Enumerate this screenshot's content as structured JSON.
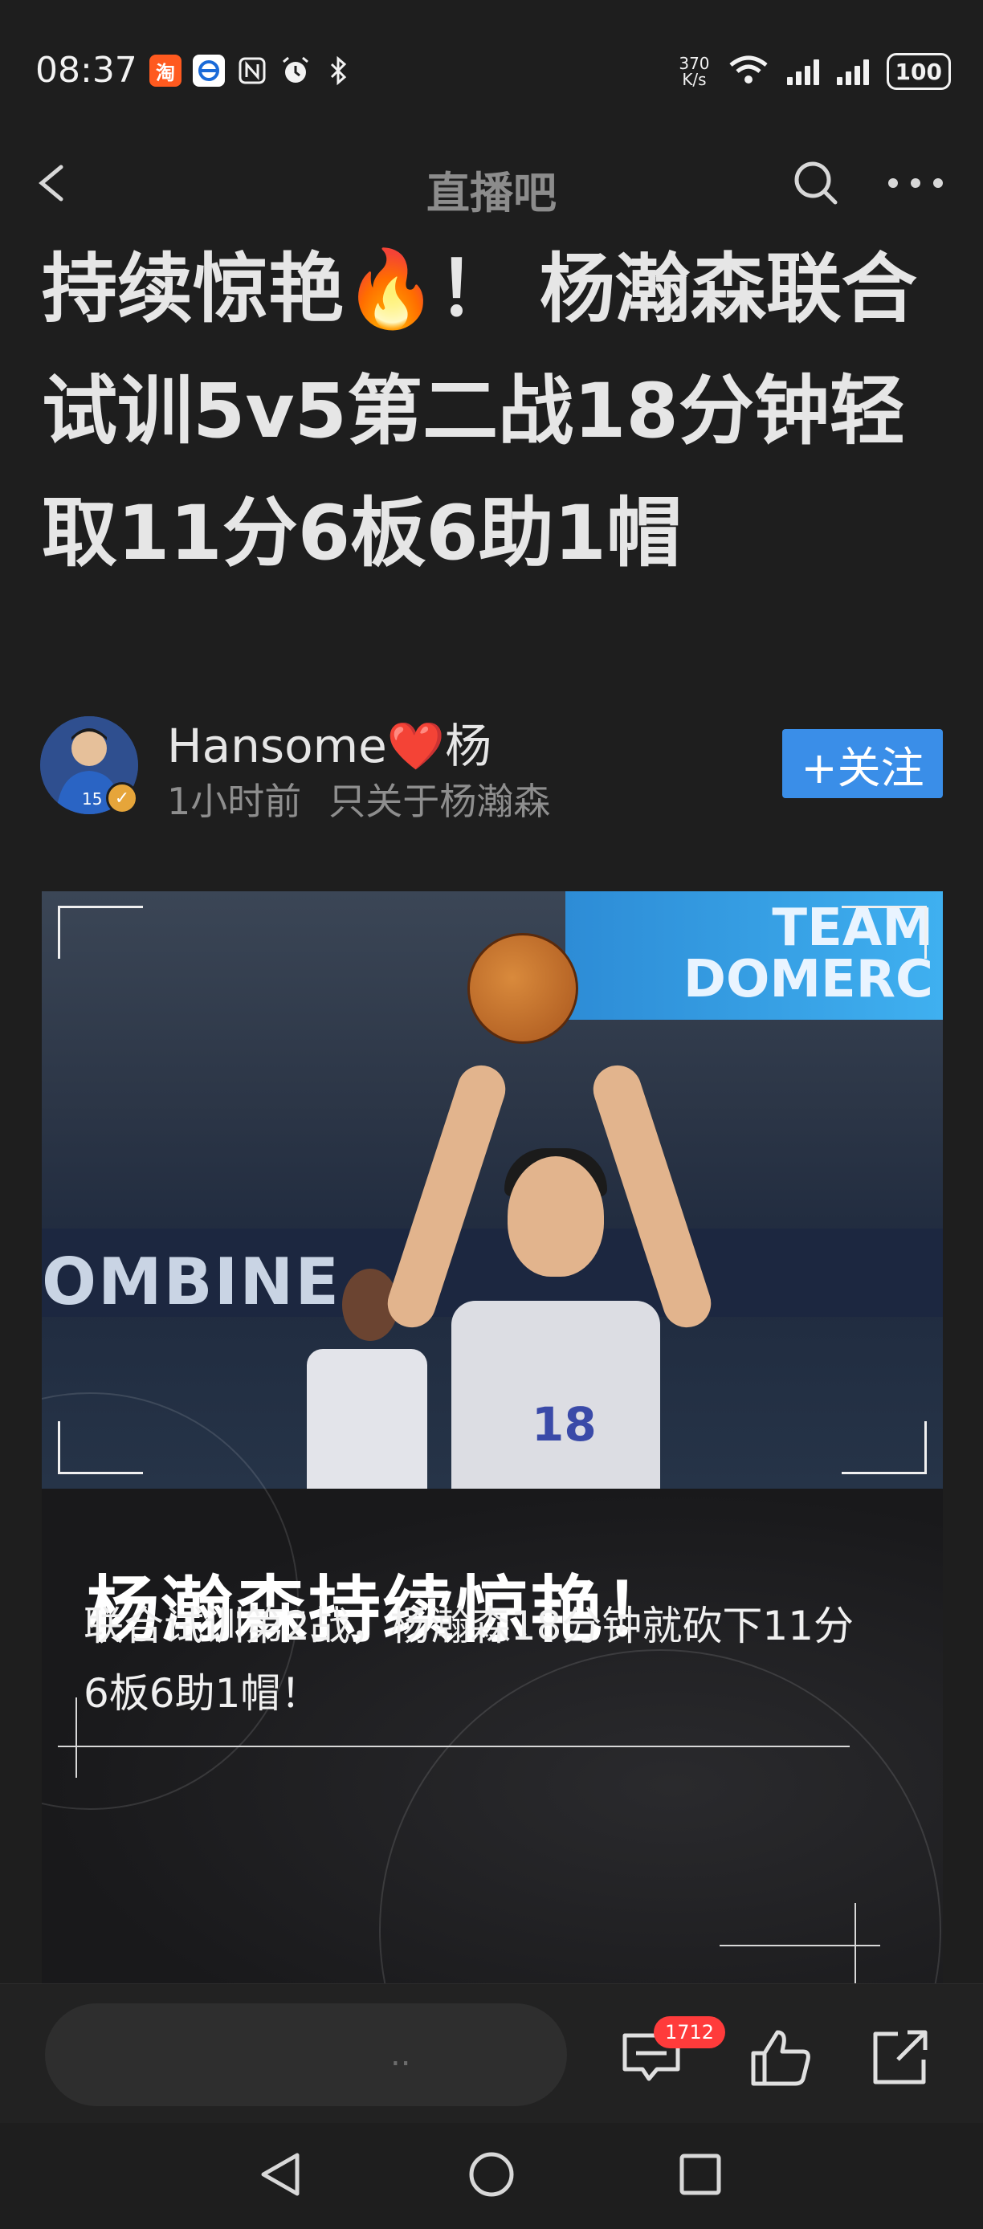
{
  "status_bar": {
    "time": "08:37",
    "left_icons": [
      "taobao-icon",
      "telecom-icon",
      "nfc-icon",
      "alarm-icon",
      "bluetooth-icon"
    ],
    "net_speed_value": "370",
    "net_speed_unit": "K/s",
    "battery": "100"
  },
  "nav": {
    "title": "直播吧"
  },
  "post": {
    "title": "持续惊艳🔥！ 杨瀚森联合试训5v5第二战18分钟轻取11分6板6助1帽"
  },
  "author": {
    "name": "Hansome❤️杨",
    "time": "1小时前",
    "tagline": "只关于杨瀚森",
    "follow_label": "+关注",
    "avatar_number": "15"
  },
  "image": {
    "screen_text_1": "TEAM",
    "screen_text_2": "DOMERC",
    "banner_text": "OMBINE",
    "jersey_number": "18",
    "caption_title": "杨瀚森持续惊艳！",
    "caption_text": "联合试训第2战，杨瀚森18分钟就砍下11分6板6助1帽！"
  },
  "action_bar": {
    "comment_placeholder": "..",
    "comment_count": "1712"
  },
  "colors": {
    "background": "#1e1e1e",
    "follow_button": "#3a8ee8",
    "badge": "#ff3b3b"
  }
}
